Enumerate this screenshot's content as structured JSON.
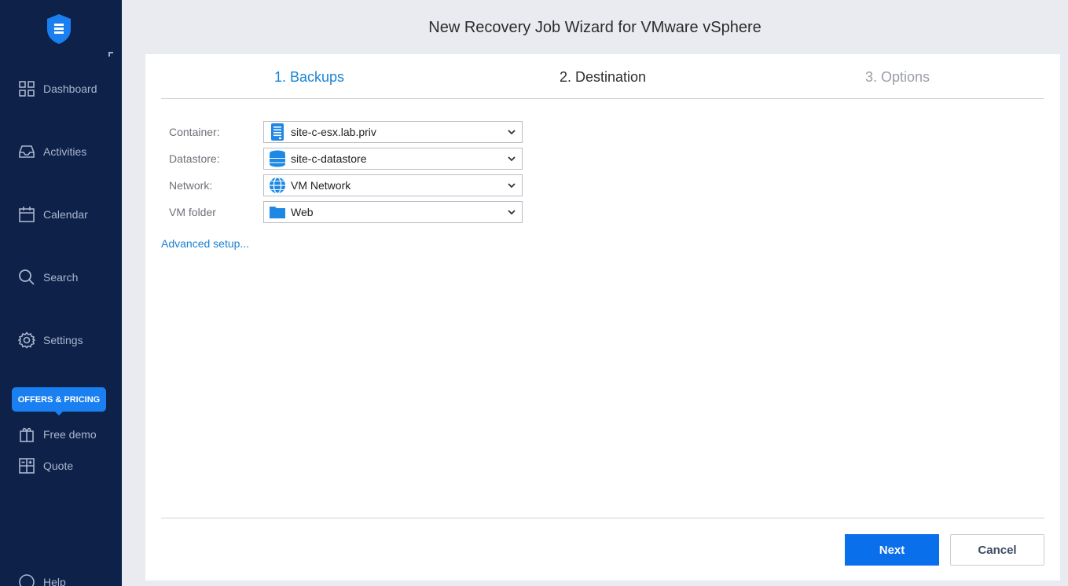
{
  "window": {
    "title": "New Recovery Job Wizard for VMware vSphere"
  },
  "sidebar": {
    "logo_icon": "shield-icon",
    "items": [
      {
        "label": "Dashboard",
        "icon": "dashboard-grid-icon"
      },
      {
        "label": "Activities",
        "icon": "inbox-tray-icon"
      },
      {
        "label": "Calendar",
        "icon": "calendar-icon"
      },
      {
        "label": "Search",
        "icon": "search-icon"
      },
      {
        "label": "Settings",
        "icon": "gear-icon"
      }
    ],
    "offers_label": "OFFERS & PRICING",
    "extra_items": [
      {
        "label": "Free demo",
        "icon": "gift-icon"
      },
      {
        "label": "Quote",
        "icon": "calculator-icon"
      }
    ],
    "help_label": "Help",
    "colors": {
      "background": "#0d2149",
      "text": "#aab6cf",
      "accent": "#1a7ff0"
    }
  },
  "wizard": {
    "steps": [
      {
        "label": "1. Backups",
        "state": "completed"
      },
      {
        "label": "2. Destination",
        "state": "active"
      },
      {
        "label": "3. Options",
        "state": "pending"
      }
    ],
    "fields": [
      {
        "label": "Container:",
        "value": "site-c-esx.lab.priv",
        "icon": "host-server-icon"
      },
      {
        "label": "Datastore:",
        "value": "site-c-datastore",
        "icon": "datastore-icon"
      },
      {
        "label": "Network:",
        "value": "VM Network",
        "icon": "network-globe-icon"
      },
      {
        "label": "VM folder",
        "value": "Web",
        "icon": "folder-icon"
      }
    ],
    "advanced_link": "Advanced setup...",
    "buttons": {
      "next": "Next",
      "cancel": "Cancel"
    },
    "colors": {
      "primary": "#0a6fea",
      "link": "#1a7fd0"
    }
  }
}
